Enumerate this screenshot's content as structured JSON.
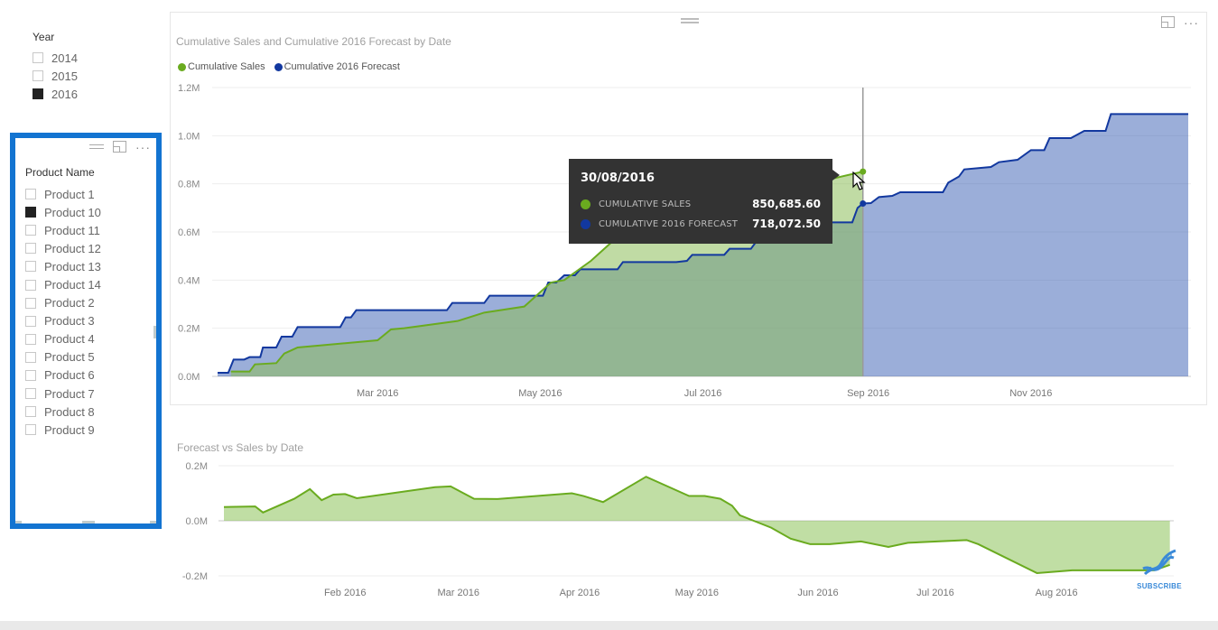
{
  "year_slicer": {
    "title": "Year",
    "items": [
      {
        "label": "2014",
        "checked": false
      },
      {
        "label": "2015",
        "checked": false
      },
      {
        "label": "2016",
        "checked": true
      }
    ]
  },
  "product_slicer": {
    "title": "Product Name",
    "items": [
      {
        "label": "Product 1",
        "checked": false
      },
      {
        "label": "Product 10",
        "checked": true
      },
      {
        "label": "Product 11",
        "checked": false
      },
      {
        "label": "Product 12",
        "checked": false
      },
      {
        "label": "Product 13",
        "checked": false
      },
      {
        "label": "Product 14",
        "checked": false
      },
      {
        "label": "Product 2",
        "checked": false
      },
      {
        "label": "Product 3",
        "checked": false
      },
      {
        "label": "Product 4",
        "checked": false
      },
      {
        "label": "Product 5",
        "checked": false
      },
      {
        "label": "Product 6",
        "checked": false
      },
      {
        "label": "Product 7",
        "checked": false
      },
      {
        "label": "Product 8",
        "checked": false
      },
      {
        "label": "Product 9",
        "checked": false
      }
    ],
    "accent": "#1374d1"
  },
  "icons": {
    "more": "···"
  },
  "tooltip": {
    "date": "30/08/2016",
    "rows": [
      {
        "label": "Cumulative Sales",
        "value": "850,685.60",
        "color": "#6aab1f"
      },
      {
        "label": "Cumulative 2016 Forecast",
        "value": "718,072.50",
        "color": "#12389f"
      }
    ]
  },
  "subscribe": {
    "label": "SUBSCRIBE",
    "color": "#3a8ad8"
  },
  "chart_data": [
    {
      "type": "area",
      "title": "Cumulative Sales and Cumulative 2016 Forecast by Date",
      "xlabel": "",
      "ylabel": "",
      "x_range_days": [
        0,
        365
      ],
      "ylim": [
        0,
        1200000
      ],
      "yticks": [
        0,
        200000,
        400000,
        600000,
        800000,
        1000000,
        1200000
      ],
      "ytick_labels": [
        "0.0M",
        "0.2M",
        "0.4M",
        "0.6M",
        "0.8M",
        "1.0M",
        "1.2M"
      ],
      "xticks_days": [
        60,
        121,
        182,
        244,
        305
      ],
      "xtick_labels": [
        "Mar 2016",
        "May 2016",
        "Jul 2016",
        "Sep 2016",
        "Nov 2016"
      ],
      "legend": "top-left",
      "grid": true,
      "hover_day": 242,
      "series": [
        {
          "name": "Cumulative Sales",
          "color": "#6aab1f",
          "points": [
            [
              5,
              20000
            ],
            [
              12,
              20000
            ],
            [
              14,
              50000
            ],
            [
              22,
              55000
            ],
            [
              25,
              95000
            ],
            [
              28,
              110000
            ],
            [
              30,
              120000
            ],
            [
              60,
              150000
            ],
            [
              65,
              195000
            ],
            [
              70,
              200000
            ],
            [
              90,
              230000
            ],
            [
              100,
              265000
            ],
            [
              115,
              290000
            ],
            [
              125,
              390000
            ],
            [
              130,
              400000
            ],
            [
              140,
              480000
            ],
            [
              150,
              580000
            ],
            [
              162,
              610000
            ],
            [
              175,
              620000
            ],
            [
              200,
              690000
            ],
            [
              215,
              760000
            ],
            [
              230,
              820000
            ],
            [
              242,
              850686
            ]
          ]
        },
        {
          "name": "Cumulative 2016 Forecast",
          "color": "#12389f",
          "points": [
            [
              0,
              15000
            ],
            [
              4,
              15000
            ],
            [
              6,
              70000
            ],
            [
              10,
              70000
            ],
            [
              12,
              80000
            ],
            [
              16,
              80000
            ],
            [
              17,
              120000
            ],
            [
              22,
              120000
            ],
            [
              24,
              165000
            ],
            [
              28,
              165000
            ],
            [
              30,
              205000
            ],
            [
              46,
              205000
            ],
            [
              48,
              245000
            ],
            [
              50,
              245000
            ],
            [
              52,
              275000
            ],
            [
              86,
              275000
            ],
            [
              88,
              305000
            ],
            [
              100,
              305000
            ],
            [
              102,
              335000
            ],
            [
              122,
              335000
            ],
            [
              124,
              390000
            ],
            [
              127,
              390000
            ],
            [
              130,
              420000
            ],
            [
              134,
              420000
            ],
            [
              136,
              445000
            ],
            [
              150,
              445000
            ],
            [
              152,
              475000
            ],
            [
              172,
              475000
            ],
            [
              176,
              480000
            ],
            [
              178,
              505000
            ],
            [
              190,
              505000
            ],
            [
              192,
              530000
            ],
            [
              200,
              530000
            ],
            [
              202,
              560000
            ],
            [
              210,
              560000
            ],
            [
              212,
              600000
            ],
            [
              225,
              600000
            ],
            [
              227,
              640000
            ],
            [
              238,
              640000
            ],
            [
              240,
              700000
            ],
            [
              242,
              718073
            ],
            [
              245,
              720000
            ],
            [
              248,
              745000
            ],
            [
              253,
              750000
            ],
            [
              256,
              765000
            ],
            [
              272,
              765000
            ],
            [
              274,
              805000
            ],
            [
              278,
              830000
            ],
            [
              280,
              860000
            ],
            [
              290,
              870000
            ],
            [
              293,
              890000
            ],
            [
              300,
              900000
            ],
            [
              305,
              940000
            ],
            [
              310,
              940000
            ],
            [
              312,
              990000
            ],
            [
              320,
              990000
            ],
            [
              325,
              1020000
            ],
            [
              333,
              1020000
            ],
            [
              335,
              1090000
            ],
            [
              364,
              1090000
            ]
          ]
        }
      ]
    },
    {
      "type": "area",
      "title": "Forecast vs Sales by Date",
      "xlabel": "",
      "ylabel": "",
      "x_range_days": [
        0,
        243
      ],
      "ylim": [
        -200000,
        200000
      ],
      "yticks": [
        -200000,
        0,
        200000
      ],
      "ytick_labels": [
        "-0.2M",
        "0.0M",
        "0.2M"
      ],
      "xticks_days": [
        31,
        60,
        91,
        121,
        152,
        182,
        213
      ],
      "xtick_labels": [
        "Feb 2016",
        "Mar 2016",
        "Apr 2016",
        "May 2016",
        "Jun 2016",
        "Jul 2016",
        "Aug 2016"
      ],
      "legend": "none",
      "grid": true,
      "series": [
        {
          "name": "Forecast vs Sales",
          "color": "#6aab1f",
          "points": [
            [
              0,
              50000
            ],
            [
              8,
              52000
            ],
            [
              10,
              30000
            ],
            [
              18,
              80000
            ],
            [
              22,
              115000
            ],
            [
              25,
              75000
            ],
            [
              28,
              95000
            ],
            [
              31,
              97000
            ],
            [
              34,
              82000
            ],
            [
              54,
              122000
            ],
            [
              58,
              125000
            ],
            [
              64,
              80000
            ],
            [
              70,
              79000
            ],
            [
              89,
              100000
            ],
            [
              92,
              90000
            ],
            [
              97,
              68000
            ],
            [
              108,
              160000
            ],
            [
              119,
              90000
            ],
            [
              123,
              90000
            ],
            [
              127,
              80000
            ],
            [
              130,
              55000
            ],
            [
              132,
              20000
            ],
            [
              140,
              -25000
            ],
            [
              145,
              -65000
            ],
            [
              150,
              -85000
            ],
            [
              155,
              -85000
            ],
            [
              163,
              -75000
            ],
            [
              170,
              -95000
            ],
            [
              175,
              -80000
            ],
            [
              190,
              -70000
            ],
            [
              193,
              -85000
            ],
            [
              208,
              -190000
            ],
            [
              217,
              -180000
            ],
            [
              238,
              -180000
            ],
            [
              242,
              -160000
            ]
          ]
        }
      ]
    }
  ]
}
